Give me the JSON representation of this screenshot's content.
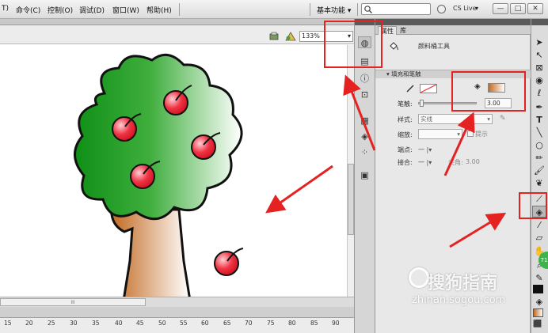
{
  "menubar": {
    "items": [
      "T)",
      "命令(C)",
      "控制(O)",
      "调试(D)",
      "窗口(W)",
      "帮助(H)"
    ],
    "workspace": "基本功能",
    "workspace_arrow": "▾",
    "cs_live": "CS Live",
    "win_buttons": [
      "—",
      "□",
      "✕"
    ]
  },
  "stage": {
    "zoom": "133%",
    "ruler_ticks": [
      "15",
      "20",
      "25",
      "30",
      "35",
      "40",
      "45",
      "50",
      "55",
      "60",
      "65",
      "70",
      "75",
      "80",
      "85",
      "90"
    ],
    "hscroll_grip": "III"
  },
  "properties": {
    "tab_properties": "属性",
    "tab_library": "库",
    "tool_name": "颜料桶工具",
    "section_title": "填充和笔触",
    "stroke_label": "笔触:",
    "stroke_value": "3.00",
    "style_label": "样式:",
    "style_value": "实线",
    "scale_label": "缩放:",
    "hint_label": "提示",
    "cap_label": "端点:",
    "join_label": "接合:",
    "miter_label": "尖角:",
    "miter_value": "3.00",
    "dash": "一 |▾"
  },
  "tools": {
    "icons": [
      "selection-icon",
      "subselection-icon",
      "free-transform-icon",
      "3d-rotation-icon",
      "lasso-icon",
      "pen-icon",
      "text-icon",
      "line-icon",
      "oval-icon",
      "pencil-icon",
      "brush-icon",
      "deco-icon",
      "bone-icon",
      "paint-bucket-icon",
      "eyedropper-icon",
      "eraser-icon",
      "hand-icon",
      "zoom-icon",
      "stroke-color-icon",
      "fill-color-icon"
    ],
    "badge": "71"
  },
  "watermark": {
    "brand": "搜狗指南",
    "url": "zhinan.sogou.com"
  },
  "colors": {
    "highlight": "#e52222",
    "tree_green": "#1e9c1e",
    "trunk": "#c9722a",
    "apple": "#e8283a"
  }
}
